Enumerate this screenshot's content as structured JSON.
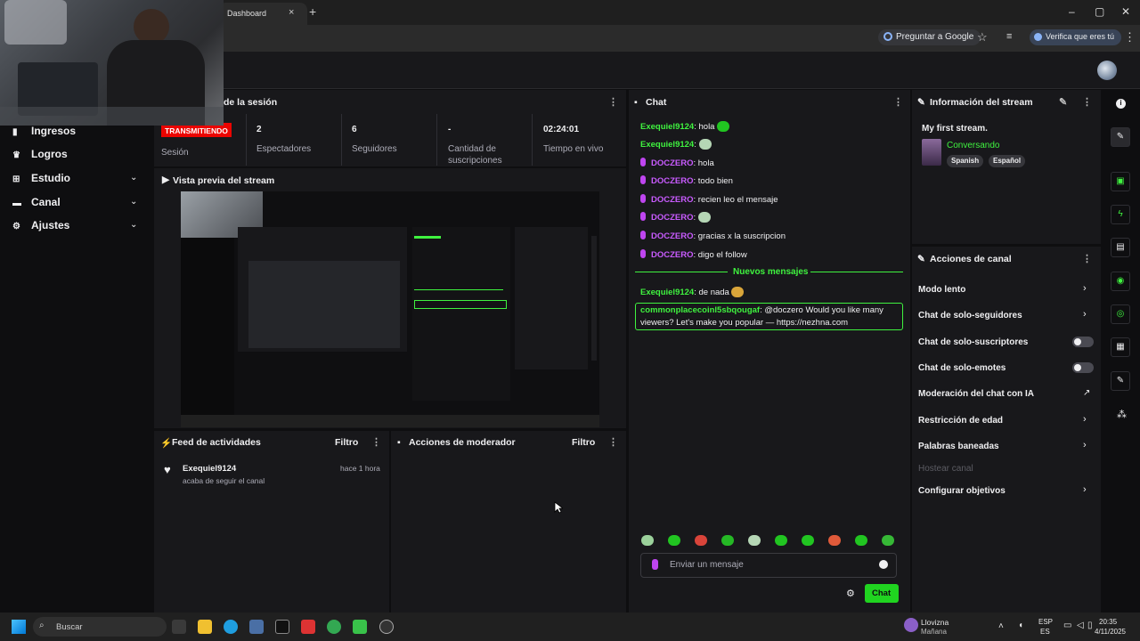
{
  "browser": {
    "tab_title": "Dashboard",
    "tab_close": "×",
    "new_tab": "+",
    "ask_google": "Preguntar a Google",
    "verify": "Verifica que eres tú",
    "win_min": "–",
    "win_max": "▢",
    "win_close": "✕"
  },
  "sidebar": {
    "items": [
      {
        "label": "Ingresos",
        "icon": "bar-chart-icon",
        "glyph": "▮"
      },
      {
        "label": "Logros",
        "icon": "trophy-icon",
        "glyph": "♛"
      },
      {
        "label": "Estudio",
        "icon": "studio-icon",
        "glyph": "⊞"
      },
      {
        "label": "Canal",
        "icon": "channel-icon",
        "glyph": "▬"
      },
      {
        "label": "Ajustes",
        "icon": "gear-icon",
        "glyph": "⚙"
      }
    ]
  },
  "session": {
    "title": "de la sesión",
    "status": "TRANSMITIENDO",
    "status_label": "Sesión",
    "stats": [
      {
        "value": "2",
        "label": "Espectadores"
      },
      {
        "value": "6",
        "label": "Seguidores"
      },
      {
        "value": "-",
        "label": "Cantidad de suscripciones"
      },
      {
        "value": "02:24:01",
        "label": "Tiempo en vivo"
      }
    ]
  },
  "preview": {
    "title": "Vista previa del stream"
  },
  "activity": {
    "title": "Feed de actividades",
    "filter": "Filtro",
    "items": [
      {
        "user": "Exequiel9124",
        "action": "acaba de seguir el canal",
        "time": "hace 1 hora"
      }
    ]
  },
  "moderator": {
    "title": "Acciones de moderador",
    "filter": "Filtro"
  },
  "chat": {
    "title": "Chat",
    "messages": [
      {
        "user": "Exequiel9124",
        "text": ": hola",
        "type": "g"
      },
      {
        "user": "Exequiel9124",
        "text": ":",
        "type": "g"
      },
      {
        "user": "DOCZERO",
        "text": ": hola",
        "type": "p"
      },
      {
        "user": "DOCZERO",
        "text": ": todo bien",
        "type": "p"
      },
      {
        "user": "DOCZERO",
        "text": ": recien leo el mensaje",
        "type": "p"
      },
      {
        "user": "DOCZERO",
        "text": ":",
        "type": "p"
      },
      {
        "user": "DOCZERO",
        "text": ": gracias x la suscripcion",
        "type": "p"
      },
      {
        "user": "DOCZERO",
        "text": ": digo el follow",
        "type": "p"
      }
    ],
    "new_messages": "Nuevos mensajes",
    "after": {
      "user": "Exequiel9124",
      "text": ": de nada"
    },
    "highlight_user": "commonplacecoinl5sbqougaf",
    "highlight_line1": ": @doczero Would you like many",
    "highlight_line2": "viewers? Let's make you popular — https://nezhna.com",
    "input_placeholder": "Enviar un mensaje",
    "send": "Chat",
    "emote_colors": [
      "#9bd19b",
      "#21c521",
      "#d9443a",
      "#25b825",
      "#b5d6b5",
      "#21c521",
      "#21c521",
      "#e05a3a",
      "#21c521",
      "#36b836"
    ]
  },
  "stream_info": {
    "title": "Información del stream",
    "stream_title": "My first stream.",
    "category": "Conversando",
    "tags": [
      "Spanish",
      "Español"
    ]
  },
  "channel_actions": {
    "title": "Acciones de canal",
    "items": [
      {
        "label": "Modo lento",
        "kind": "chevron"
      },
      {
        "label": "Chat de solo-seguidores",
        "kind": "chevron"
      },
      {
        "label": "Chat de solo-suscriptores",
        "kind": "toggle"
      },
      {
        "label": "Chat de solo-emotes",
        "kind": "toggle"
      },
      {
        "label": "Moderación del chat con IA",
        "kind": "external"
      },
      {
        "label": "Restricción de edad",
        "kind": "chevron"
      },
      {
        "label": "Palabras baneadas",
        "kind": "chevron"
      },
      {
        "label": "Hostear canal",
        "kind": "disabled"
      },
      {
        "label": "Configurar objetivos",
        "kind": "chevron"
      }
    ]
  },
  "taskbar": {
    "search": "Buscar",
    "weather": "Llovizna",
    "weather_sub": "Mañana",
    "lang1": "ESP",
    "lang2": "ES",
    "time": "20:35",
    "date": "4/11/2025"
  },
  "colors": {
    "accent": "#3ff23f",
    "live": "#eb0400",
    "mod": "#c95bff"
  }
}
